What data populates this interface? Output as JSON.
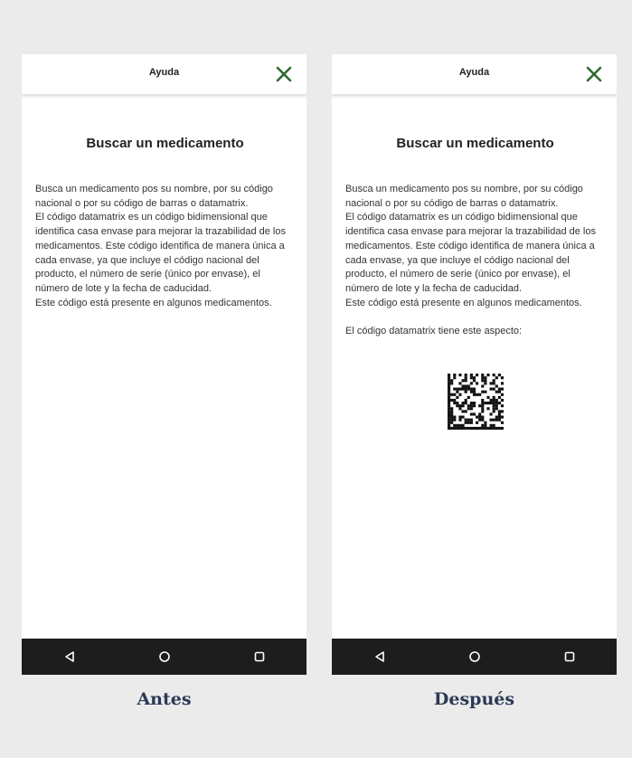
{
  "colors": {
    "background": "#ebebeb",
    "close_icon": "#2e6b2e",
    "navbar": "#1d1d1d",
    "caption": "#2b3a55"
  },
  "screens": [
    {
      "app_bar_title": "Ayuda",
      "close_icon": "close-icon",
      "heading": "Buscar un medicamento",
      "body": "Busca un medicamento pos su nombre, por su código nacional o por su código de barras o datamatrix.\nEl código datamatrix es un código bidimensional que identifica casa envase para mejorar la trazabilidad de los medicamentos. Este código identifica de manera única a cada envase, ya que incluye el código nacional del producto, el número de serie (único por envase), el número de lote y la fecha de caducidad.\nEste código  está presente en algunos medicamentos.",
      "caption": "Antes"
    },
    {
      "app_bar_title": "Ayuda",
      "close_icon": "close-icon",
      "heading": "Buscar un medicamento",
      "body": "Busca un medicamento pos su nombre, por su código nacional o por su código de barras o datamatrix.\nEl código datamatrix es un código bidimensional que identifica casa envase para mejorar la trazabilidad de los medicamentos. Este código identifica de manera única a cada envase, ya que incluye el código nacional del producto, el número de serie (único por envase), el número de lote y la fecha de caducidad.\nEste código  está presente en algunos medicamentos.",
      "extra_text": "El código datamatrix tiene este aspecto:",
      "image": "datamatrix-code",
      "caption": "Después"
    }
  ],
  "nav_icons": [
    "back-triangle-icon",
    "home-circle-icon",
    "recents-square-icon"
  ]
}
